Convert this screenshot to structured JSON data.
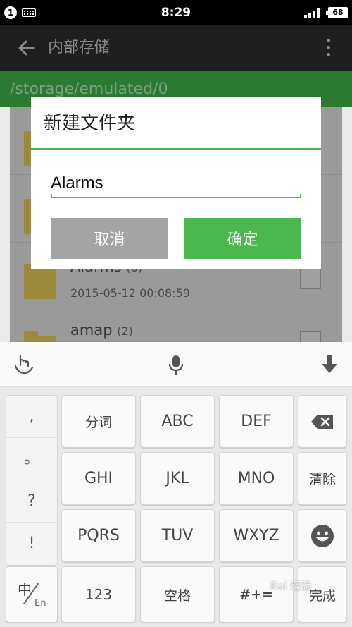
{
  "status_bar": {
    "notification_count": "1",
    "time": "8:29",
    "battery": "68"
  },
  "app_bar": {
    "title": "内部存储"
  },
  "path_bar": {
    "path": "/storage/emulated/0"
  },
  "file_list": {
    "items": [
      {
        "name": "Alarms",
        "count": "(6)",
        "date": "2015-05-12 00:08:59"
      },
      {
        "name": "amap",
        "count": "(2)"
      }
    ]
  },
  "dialog": {
    "title": "新建文件夹",
    "input_value": "Alarms",
    "cancel_label": "取消",
    "ok_label": "确定"
  },
  "keyboard": {
    "punctuation": [
      ",",
      "。",
      "?",
      "!"
    ],
    "row1": [
      "分词",
      "ABC",
      "DEF"
    ],
    "row2": [
      "GHI",
      "JKL",
      "MNO"
    ],
    "clear_label": "清除",
    "row3": [
      "PQRS",
      "TUV",
      "WXYZ"
    ],
    "lang_zh": "中",
    "lang_en": "En",
    "num_label": "123",
    "space_label": "空格",
    "symbols_label": "#+=",
    "done_label": "完成"
  },
  "watermark": "Bai 经验",
  "colors": {
    "accent": "#4ab84f",
    "app_bar": "#1f1f1f",
    "path_bar": "#2a7a32"
  }
}
